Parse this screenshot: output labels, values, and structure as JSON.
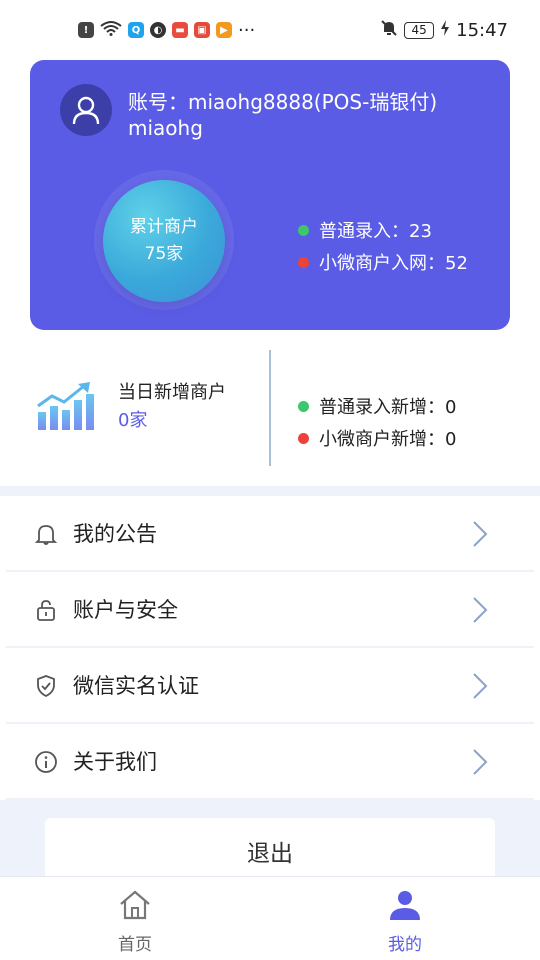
{
  "status_bar": {
    "time": "15:47",
    "battery": "45",
    "more": "···"
  },
  "account": {
    "account_line": "账号：miaohg8888(POS-瑞银付)",
    "name": "miaohg",
    "merchant_total_label": "累计商户",
    "merchant_total_value": "75家",
    "normal_entry": "普通录入：23",
    "micro_entry": "小微商户入网：52"
  },
  "daily": {
    "title": "当日新增商户",
    "count": "0家",
    "normal_new": "普通录入新增：0",
    "micro_new": "小微商户新增：0"
  },
  "menu": {
    "items": [
      {
        "label": "我的公告",
        "icon": "bell-icon"
      },
      {
        "label": "账户与安全",
        "icon": "lock-icon"
      },
      {
        "label": "微信实名认证",
        "icon": "shield-check-icon"
      },
      {
        "label": "关于我们",
        "icon": "info-icon"
      }
    ]
  },
  "logout_label": "退出",
  "tabs": {
    "home": "首页",
    "mine": "我的"
  },
  "colors": {
    "primary": "#5b5ce6",
    "green_dot": "#3dc66b",
    "red_dot": "#e8443a"
  }
}
